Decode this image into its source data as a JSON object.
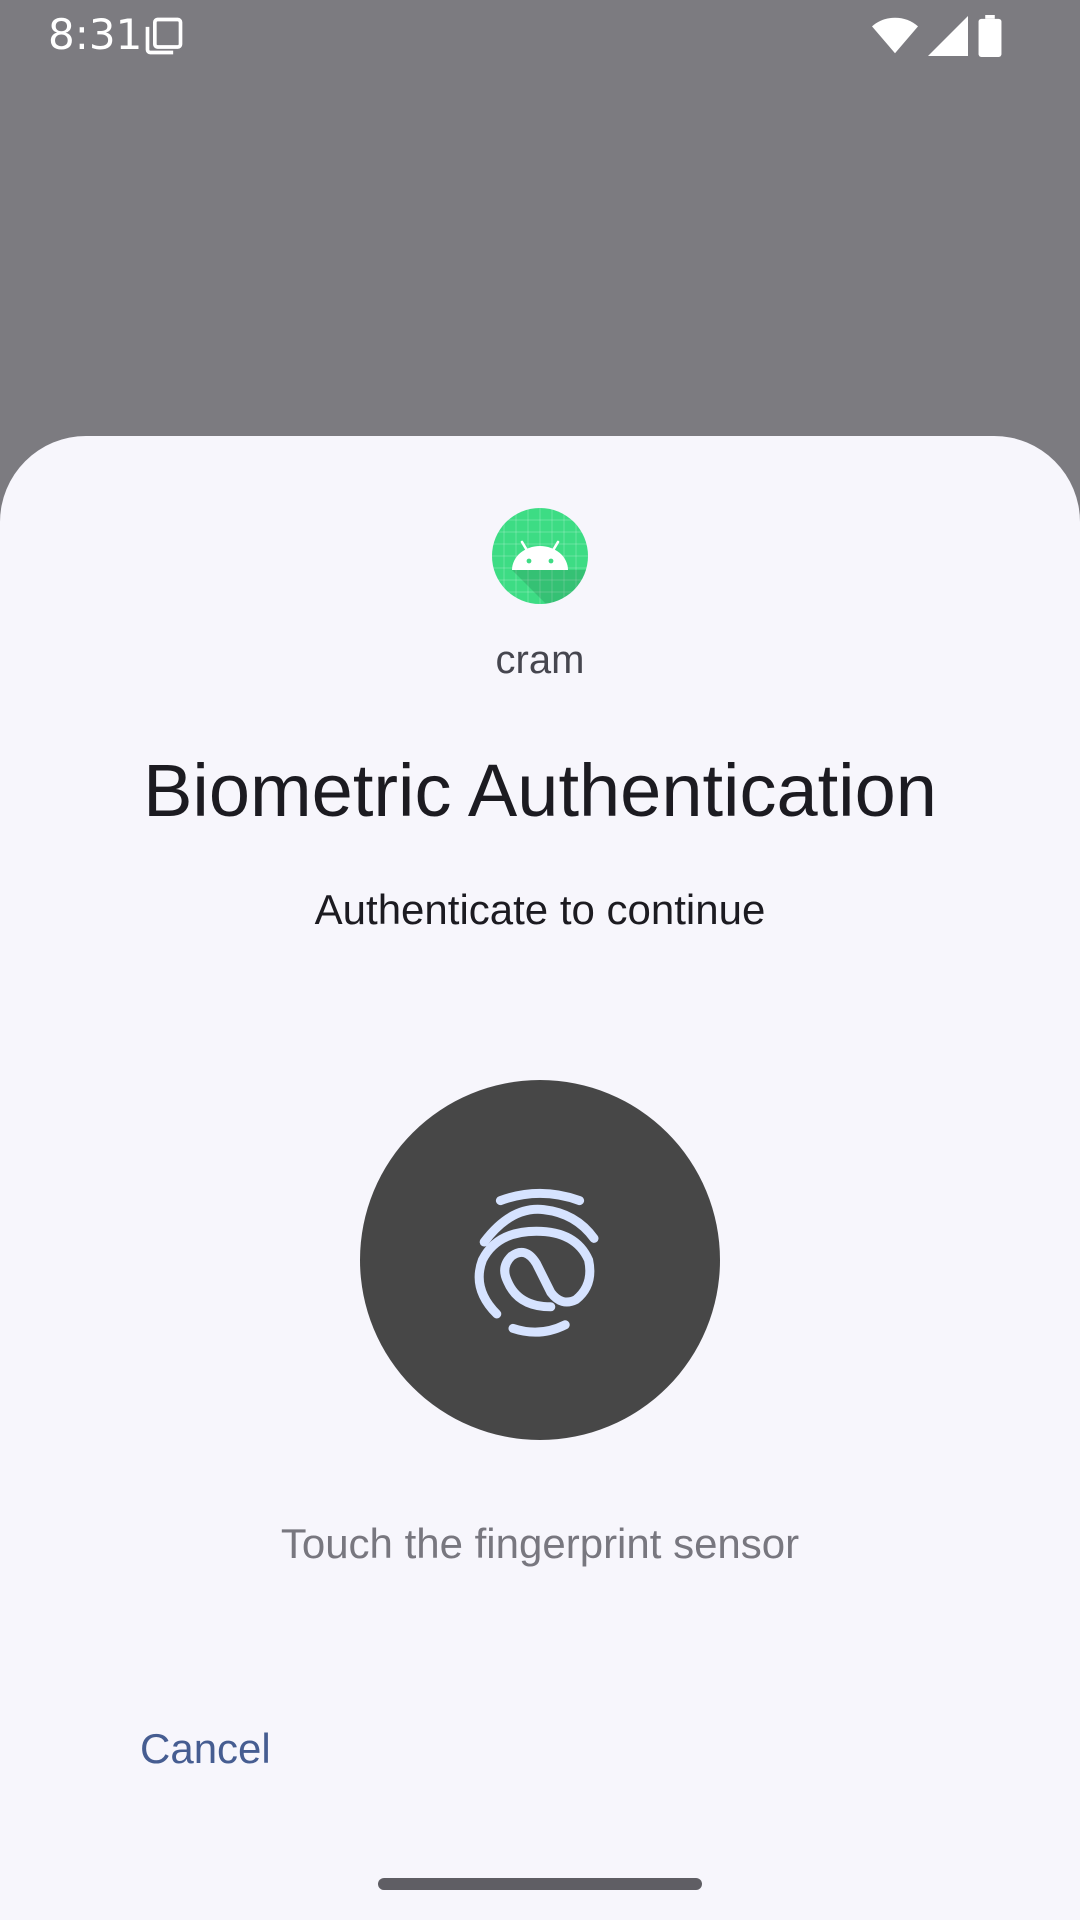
{
  "status_bar": {
    "time": "8:31",
    "icons": [
      "copy-icon",
      "wifi-icon",
      "cell-signal-icon",
      "battery-icon"
    ]
  },
  "dialog": {
    "app_icon": "android-icon",
    "app_name": "cram",
    "title": "Biometric Authentication",
    "subtitle": "Authenticate to continue",
    "fingerprint_icon": "fingerprint-icon",
    "hint": "Touch the fingerprint sensor",
    "cancel_label": "Cancel"
  },
  "colors": {
    "scrim": "#7c7b80",
    "sheet_background": "#f7f6fc",
    "fingerprint_circle": "#474747",
    "fingerprint_stroke": "#d6e3ff",
    "app_icon_green": "#3ddc84",
    "cancel_text": "#465d91"
  }
}
